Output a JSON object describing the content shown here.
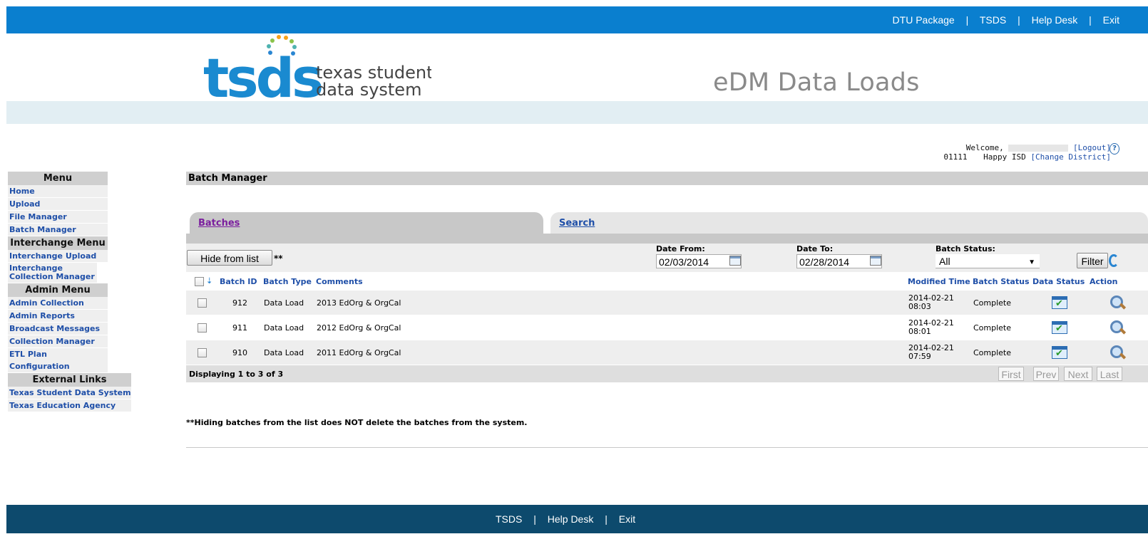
{
  "top_nav": [
    {
      "label": "DTU Package"
    },
    {
      "label": "TSDS"
    },
    {
      "label": "Help Desk"
    },
    {
      "label": "Exit"
    }
  ],
  "nav_separator": "|",
  "logo": {
    "text": "tsds",
    "tagline1": "texas student",
    "tagline2": "data system"
  },
  "app_title": "eDM Data Loads",
  "welcome": {
    "greeting": "Welcome,",
    "logout": "[Logout]",
    "district_code": "01111",
    "district_name": "Happy ISD",
    "change_district": "[Change District]"
  },
  "sidebar": {
    "menu_title": "Menu",
    "menu_items": [
      "Home",
      "Upload",
      "File Manager",
      "Batch Manager"
    ],
    "interchange_title": "Interchange Menu",
    "interchange_items": [
      "Interchange Upload",
      "Interchange Collection Manager"
    ],
    "admin_title": "Admin Menu",
    "admin_items": [
      "Admin Collection",
      "Admin Reports",
      "Broadcast Messages",
      "Collection Manager",
      "ETL Plan Configuration"
    ],
    "external_title": "External Links",
    "external_items": [
      "Texas Student Data System",
      "Texas Education Agency"
    ]
  },
  "main": {
    "page_title": "Batch Manager",
    "tabs": [
      {
        "label": "Batches"
      },
      {
        "label": "Search"
      }
    ],
    "hide_button": "Hide from list",
    "hide_marker": "**",
    "date_from_label": "Date From:",
    "date_from_value": "02/03/2014",
    "date_to_label": "Date To:",
    "date_to_value": "02/28/2014",
    "batch_status_label": "Batch Status:",
    "batch_status_value": "All",
    "filter_button": "Filter",
    "columns": {
      "batch_id": "Batch ID",
      "batch_type": "Batch Type",
      "comments": "Comments",
      "modified_time": "Modified Time",
      "batch_status": "Batch Status",
      "data_status": "Data Status",
      "action": "Action"
    },
    "rows": [
      {
        "batch_id": "912",
        "batch_type": "Data Load",
        "comments": "2013 EdOrg & OrgCal",
        "modified_date": "2014-02-21",
        "modified_time": "08:03",
        "status": "Complete"
      },
      {
        "batch_id": "911",
        "batch_type": "Data Load",
        "comments": "2012 EdOrg & OrgCal",
        "modified_date": "2014-02-21",
        "modified_time": "08:01",
        "status": "Complete"
      },
      {
        "batch_id": "910",
        "batch_type": "Data Load",
        "comments": "2011 EdOrg & OrgCal",
        "modified_date": "2014-02-21",
        "modified_time": "07:59",
        "status": "Complete"
      }
    ],
    "displaying": "Displaying 1 to 3 of 3",
    "pager": {
      "first": "First",
      "prev": "Prev",
      "next": "Next",
      "last": "Last"
    },
    "note": "**Hiding batches from the list does NOT delete the batches from the system."
  },
  "bottom_nav": [
    {
      "label": "TSDS"
    },
    {
      "label": "Help Desk"
    },
    {
      "label": "Exit"
    }
  ],
  "colors": {
    "top_bar": "#0a7fcf",
    "bottom_bar": "#0d4a6d",
    "link": "#1f4fa8",
    "visited_tab": "#7b1f9e"
  }
}
